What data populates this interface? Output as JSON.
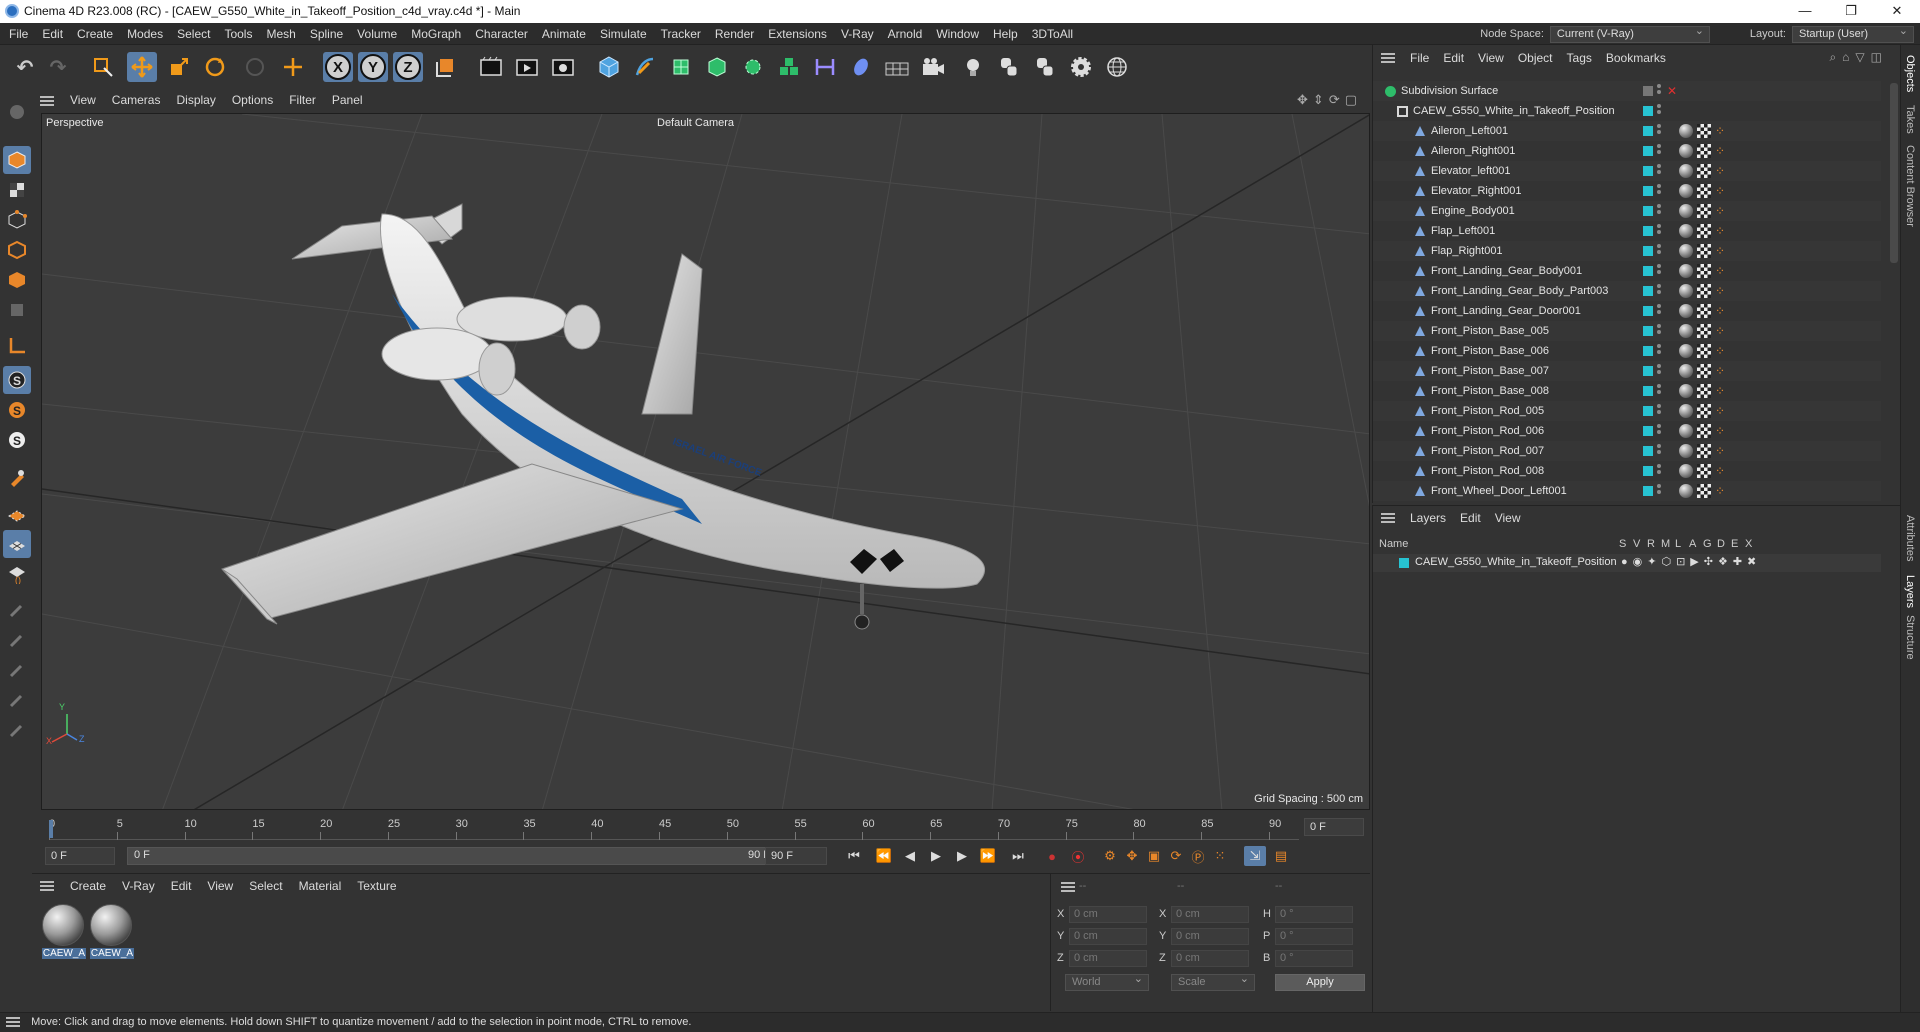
{
  "window": {
    "title": "Cinema 4D R23.008 (RC) - [CAEW_G550_White_in_Takeoff_Position_c4d_vray.c4d *] - Main",
    "minimize": "—",
    "maximize": "❐",
    "close": "✕"
  },
  "menubar": {
    "items": [
      "File",
      "Edit",
      "Create",
      "Modes",
      "Select",
      "Tools",
      "Mesh",
      "Spline",
      "Volume",
      "MoGraph",
      "Character",
      "Animate",
      "Simulate",
      "Tracker",
      "Render",
      "Extensions",
      "V-Ray",
      "Arnold",
      "Window",
      "Help",
      "3DToAll"
    ],
    "node_space_label": "Node Space:",
    "node_space_value": "Current (V-Ray)",
    "layout_label": "Layout:",
    "layout_value": "Startup (User)"
  },
  "toolbar": {
    "axes": [
      "X",
      "Y",
      "Z"
    ],
    "icons": [
      "undo-icon",
      "redo-icon",
      "live-selection-icon",
      "move-icon",
      "scale-icon",
      "rotate-icon",
      "recent-tool-icon",
      "add-object-icon",
      "x-axis-lock",
      "y-axis-lock",
      "z-axis-lock",
      "coordinate-system-icon",
      "render-view-icon",
      "render-picture-viewer-icon",
      "render-settings-icon",
      "cube-icon",
      "pen-icon",
      "subdivision-icon",
      "extrude-icon",
      "cloner-icon",
      "fracture-icon",
      "measure-icon",
      "deformer-icon",
      "floor-icon",
      "camera-icon",
      "light-icon",
      "python-icon",
      "python-script-icon",
      "settings-gear-icon",
      "globe-icon"
    ]
  },
  "viewport": {
    "menu": [
      "View",
      "Cameras",
      "Display",
      "Options",
      "Filter",
      "Panel"
    ],
    "projection": "Perspective",
    "camera": "Default Camera",
    "grid_spacing": "Grid Spacing : 500 cm",
    "livery_text": "ISRAEL AIR FORCE"
  },
  "timeline": {
    "ticks": [
      "0",
      "5",
      "10",
      "15",
      "20",
      "25",
      "30",
      "35",
      "40",
      "45",
      "50",
      "55",
      "60",
      "65",
      "70",
      "75",
      "80",
      "85",
      "90"
    ],
    "current_frame_field": "0 F",
    "start_field": "0 F",
    "range_start": "0 F",
    "range_end": "90 F",
    "end_field": "90 F"
  },
  "materials": {
    "menu": [
      "Create",
      "V-Ray",
      "Edit",
      "View",
      "Select",
      "Material",
      "Texture"
    ],
    "items": [
      "CAEW_A",
      "CAEW_A"
    ]
  },
  "coordinates": {
    "headers": [
      "--",
      "--",
      "--"
    ],
    "rows": [
      {
        "a": "X",
        "av": "0 cm",
        "b": "X",
        "bv": "0 cm",
        "c": "H",
        "cv": "0 °"
      },
      {
        "a": "Y",
        "av": "0 cm",
        "b": "Y",
        "bv": "0 cm",
        "c": "P",
        "cv": "0 °"
      },
      {
        "a": "Z",
        "av": "0 cm",
        "b": "Z",
        "bv": "0 cm",
        "c": "B",
        "cv": "0 °"
      }
    ],
    "mode1": "World",
    "mode2": "Scale",
    "apply": "Apply"
  },
  "status": "Move: Click and drag to move elements. Hold down SHIFT to quantize movement / add to the selection in point mode, CTRL to remove.",
  "objects": {
    "menu": [
      "File",
      "Edit",
      "View",
      "Object",
      "Tags",
      "Bookmarks"
    ],
    "root": "Subdivision Surface",
    "group": "CAEW_G550_White_in_Takeoff_Position",
    "children": [
      "Aileron_Left001",
      "Aileron_Right001",
      "Elevator_left001",
      "Elevator_Right001",
      "Engine_Body001",
      "Flap_Left001",
      "Flap_Right001",
      "Front_Landing_Gear_Body001",
      "Front_Landing_Gear_Body_Part003",
      "Front_Landing_Gear_Door001",
      "Front_Piston_Base_005",
      "Front_Piston_Base_006",
      "Front_Piston_Base_007",
      "Front_Piston_Base_008",
      "Front_Piston_Rod_005",
      "Front_Piston_Rod_006",
      "Front_Piston_Rod_007",
      "Front_Piston_Rod_008",
      "Front_Wheel_Door_Left001"
    ]
  },
  "layers": {
    "menu": [
      "Layers",
      "Edit",
      "View"
    ],
    "name_header": "Name",
    "flag_headers": [
      "S",
      "V",
      "R",
      "M",
      "L",
      "A",
      "G",
      "D",
      "E",
      "X"
    ],
    "rows": [
      "CAEW_G550_White_in_Takeoff_Position"
    ]
  },
  "right_tabs": [
    "Objects",
    "Takes",
    "Content Browser",
    "Attributes",
    "Layers",
    "Structure"
  ],
  "colors": {
    "accent": "#5a7ea8",
    "layer_color": "#27c3d2",
    "background": "#333333"
  }
}
